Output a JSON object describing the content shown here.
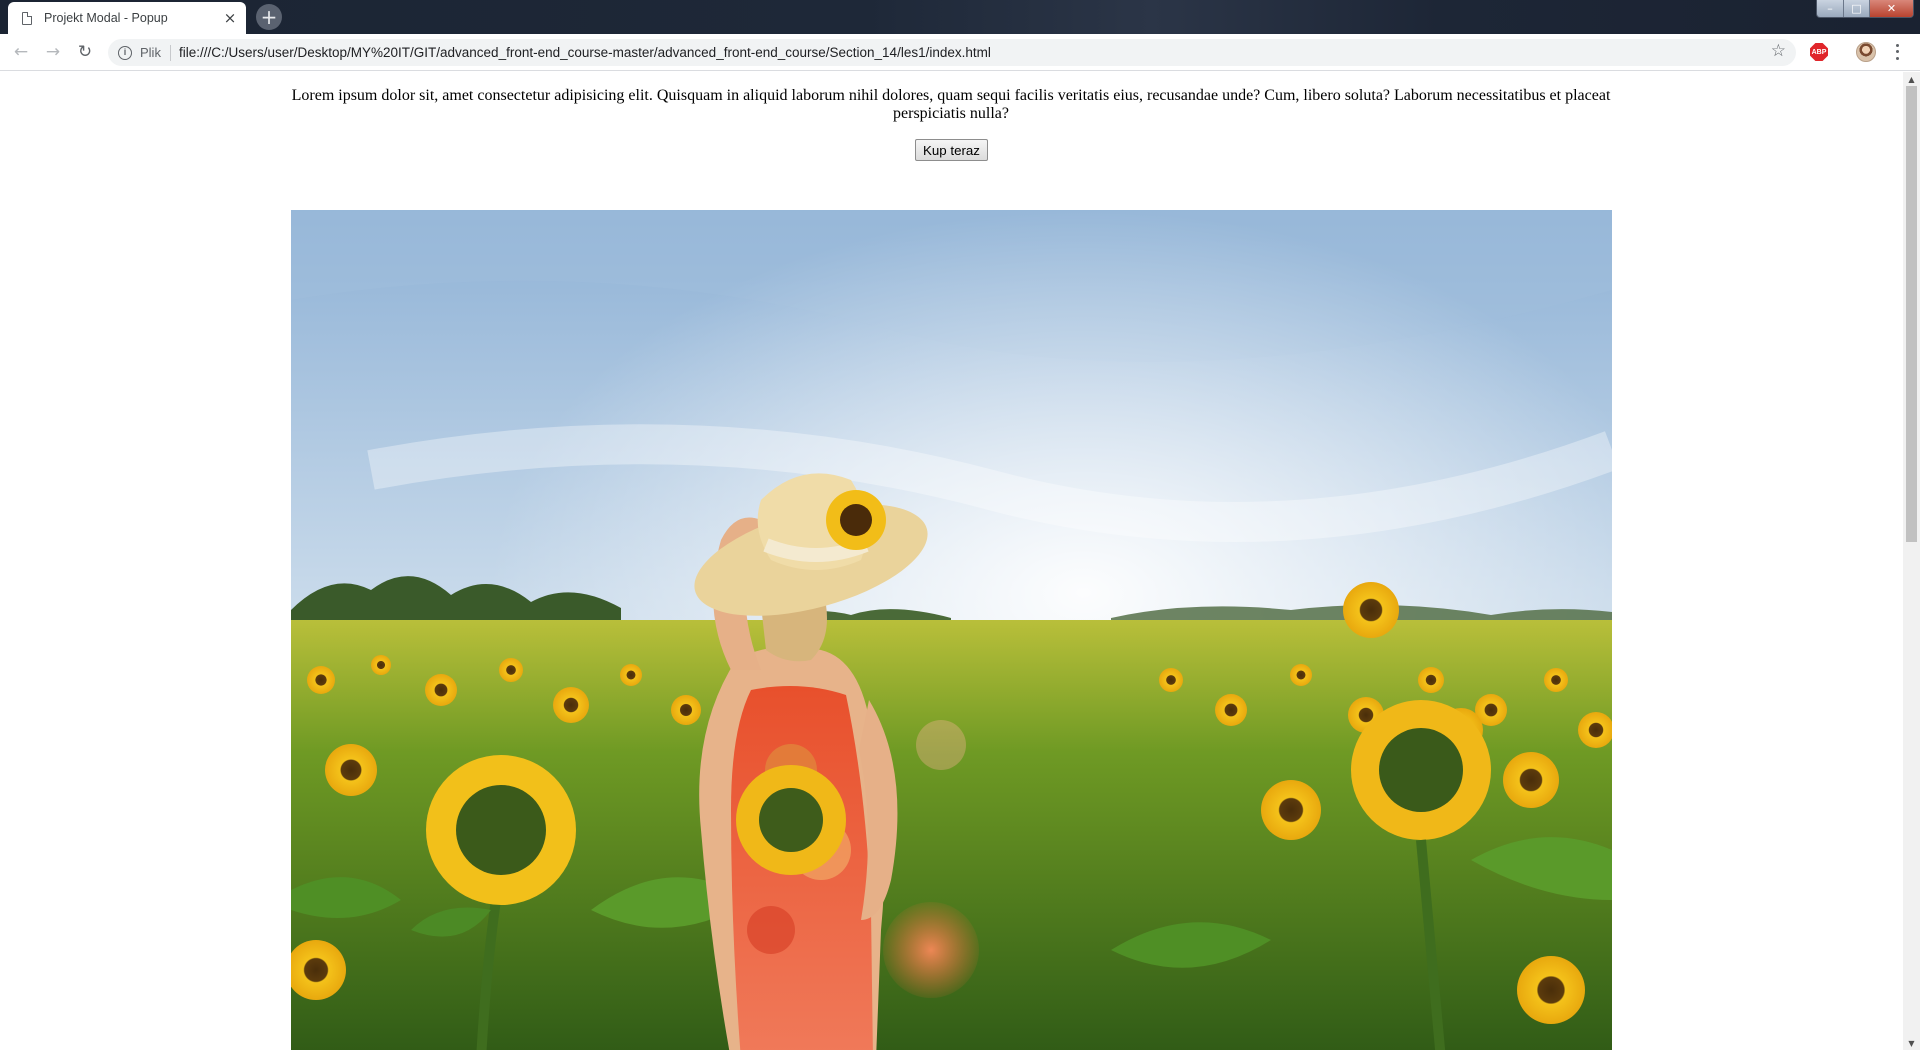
{
  "browser": {
    "tab_title": "Projekt Modal - Popup",
    "tab_close": "×",
    "new_tab": "+",
    "scheme_label": "Plik",
    "url": "file:///C:/Users/user/Desktop/MY%20IT/GIT/advanced_front-end_course-master/advanced_front-end_course/Section_14/les1/index.html",
    "extension_badge": "ABP",
    "icons": {
      "back": "arrow-left-icon",
      "forward": "arrow-right-icon",
      "reload": "reload-icon",
      "info": "info-icon",
      "bookmark": "star-icon",
      "menu": "kebab-menu-icon"
    },
    "window_controls": {
      "minimize": "–",
      "maximize": "□",
      "close": "✕"
    }
  },
  "page": {
    "paragraph": "Lorem ipsum dolor sit, amet consectetur adipisicing elit. Quisquam in aliquid laborum nihil dolores, quam sequi facilis veritatis eius, recusandae unde? Cum, libero soluta? Laborum necessitatibus et placeat perspiciatis nulla?",
    "buy_button": "Kup teraz",
    "image_description": "woman-in-sunflower-field-photo"
  },
  "scrollbar": {
    "thumb_fraction": 0.48,
    "position_fraction": 0
  }
}
